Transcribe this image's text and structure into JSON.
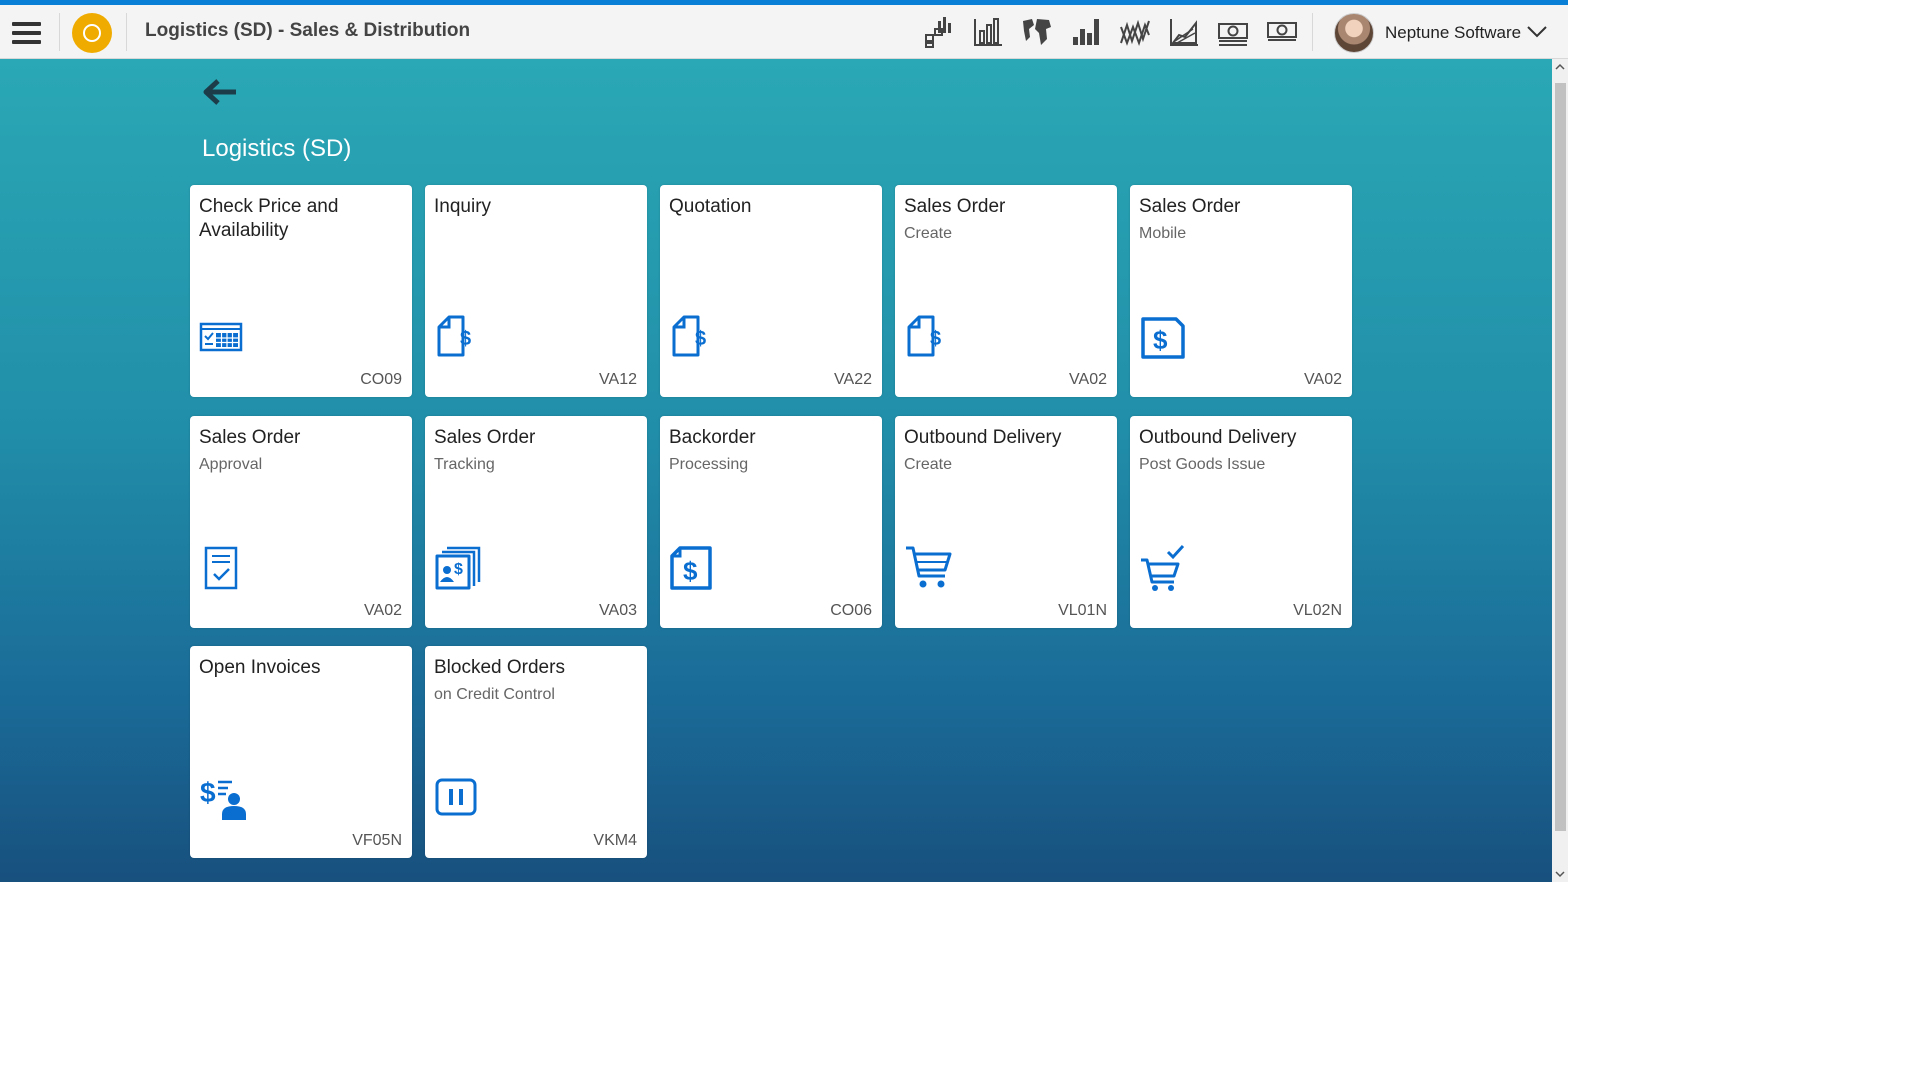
{
  "header": {
    "title": "Logistics (SD) - Sales & Distribution",
    "icons": [
      "chart-grid-icon",
      "bar-chart-icon",
      "map-chart-icon",
      "column-chart-icon",
      "line-chart-icon",
      "area-chart-icon",
      "money-icon",
      "money-bill-icon"
    ],
    "user_name": "Neptune Software"
  },
  "page": {
    "section_title": "Logistics (SD)"
  },
  "tiles": [
    {
      "title": "Check Price and Availability",
      "subtitle": "",
      "code": "CO09",
      "icon": "calendar-check-icon"
    },
    {
      "title": "Inquiry",
      "subtitle": "",
      "code": "VA12",
      "icon": "document-dollar-icon"
    },
    {
      "title": "Quotation",
      "subtitle": "",
      "code": "VA22",
      "icon": "document-dollar-icon"
    },
    {
      "title": "Sales Order",
      "subtitle": "Create",
      "code": "VA02",
      "icon": "document-dollar-icon"
    },
    {
      "title": "Sales Order",
      "subtitle": "Mobile",
      "code": "VA02",
      "icon": "sales-document-icon"
    },
    {
      "title": "Sales Order",
      "subtitle": "Approval",
      "code": "VA02",
      "icon": "approval-document-icon"
    },
    {
      "title": "Sales Order",
      "subtitle": "Tracking",
      "code": "VA03",
      "icon": "tracking-documents-icon"
    },
    {
      "title": "Backorder",
      "subtitle": "Processing",
      "code": "CO06",
      "icon": "sales-document-icon"
    },
    {
      "title": "Outbound Delivery",
      "subtitle": "Create",
      "code": "VL01N",
      "icon": "cart-icon"
    },
    {
      "title": "Outbound Delivery",
      "subtitle": "Post Goods Issue",
      "code": "VL02N",
      "icon": "cart-check-icon"
    },
    {
      "title": "Open Invoices",
      "subtitle": "",
      "code": "VF05N",
      "icon": "invoice-person-icon"
    },
    {
      "title": "Blocked Orders",
      "subtitle": "on Credit Control",
      "code": "VKM4",
      "icon": "pause-icon"
    }
  ],
  "colors": {
    "accent": "#0a7fd6",
    "icon": "#0a6ed1",
    "logo": "#f0ab00"
  }
}
